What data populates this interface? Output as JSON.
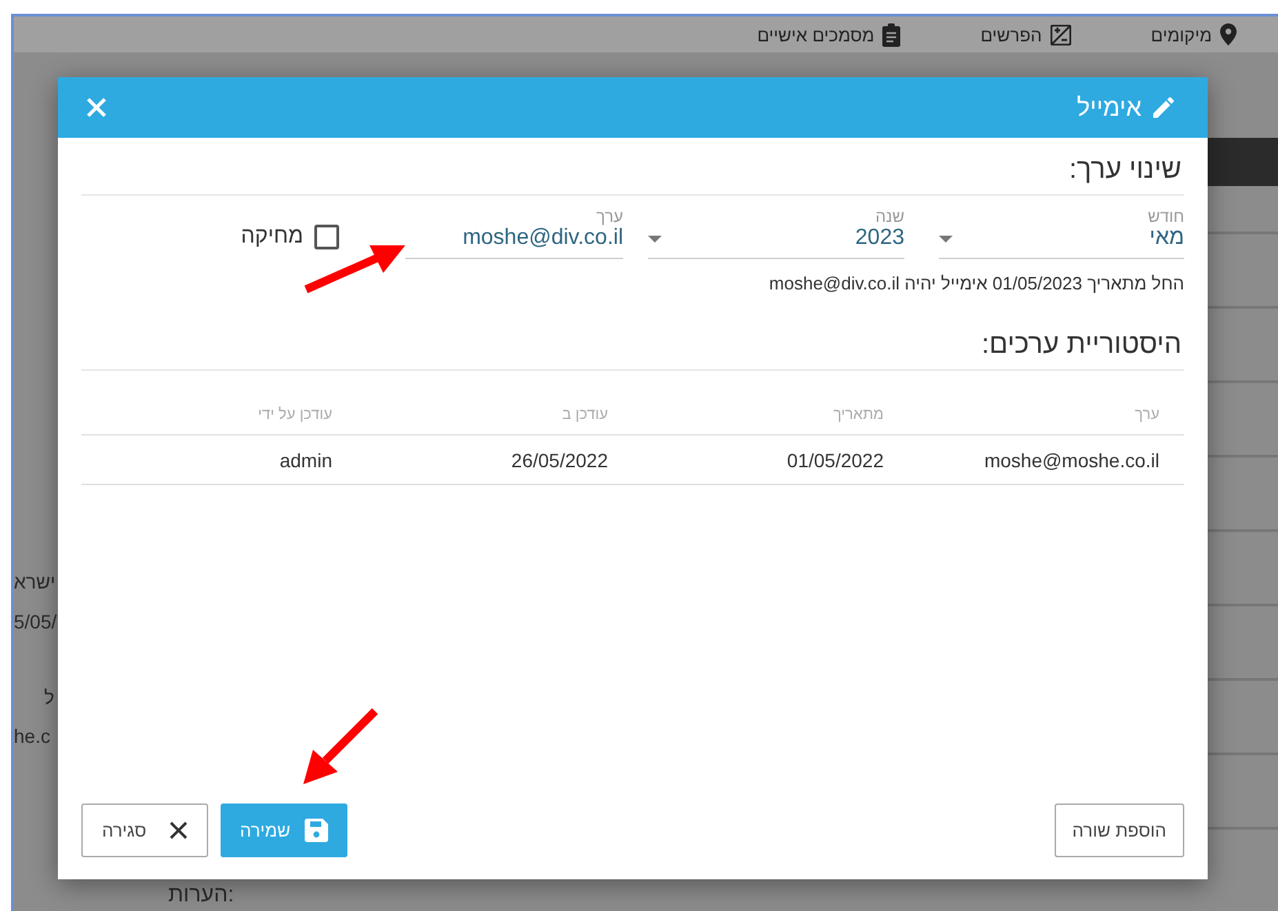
{
  "top_nav": [
    {
      "label": "מיקומים"
    },
    {
      "label": "הפרשים"
    },
    {
      "label": "מסמכים אישיים"
    }
  ],
  "background_fragments": [
    "ישרא",
    "5/05/",
    "ל",
    "he.c"
  ],
  "background_notes_label": "הערות:",
  "dialog": {
    "title": "אימייל",
    "section_title": "שינוי ערך:",
    "fields": [
      {
        "kind": "select",
        "label": "חודש",
        "value": "מאי"
      },
      {
        "kind": "select",
        "label": "שנה",
        "value": "2023"
      },
      {
        "kind": "text",
        "label": "ערך",
        "value": "moshe@div.co.il"
      }
    ],
    "delete_checkbox": {
      "label": "מחיקה",
      "checked": false
    },
    "summary": "החל מתאריך 01/05/2023 אימייל יהיה moshe@div.co.il",
    "history_title": "היסטוריית ערכים:",
    "table": {
      "columns": [
        "ערך",
        "מתאריך",
        "עודכן ב",
        "עודכן על ידי"
      ],
      "rows": [
        [
          "moshe@moshe.co.il",
          "01/05/2022",
          "26/05/2022",
          "admin"
        ]
      ]
    },
    "add_row_button": "הוספת שורה",
    "save_button": "שמירה",
    "close_button": "סגירה"
  }
}
